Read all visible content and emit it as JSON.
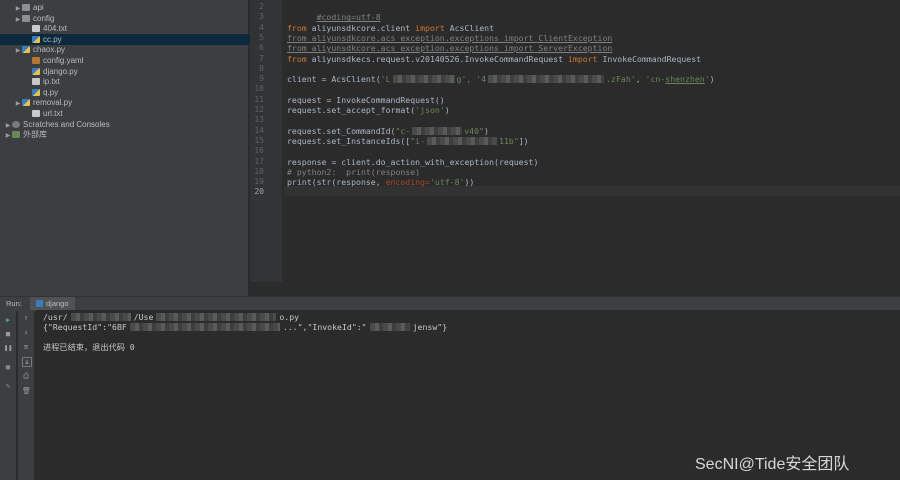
{
  "project_tree": [
    {
      "label": "api",
      "type": "folder",
      "indent": 1,
      "arrow": true,
      "selected": false
    },
    {
      "label": "config",
      "type": "folder",
      "indent": 1,
      "arrow": true,
      "selected": false
    },
    {
      "label": "404.txt",
      "type": "txt",
      "indent": 2,
      "arrow": false,
      "selected": false
    },
    {
      "label": "cc.py",
      "type": "py",
      "indent": 2,
      "arrow": false,
      "selected": true
    },
    {
      "label": "chaox.py",
      "type": "py",
      "indent": 1,
      "arrow": true,
      "selected": false
    },
    {
      "label": "config.yaml",
      "type": "yaml",
      "indent": 2,
      "arrow": false,
      "selected": false
    },
    {
      "label": "django.py",
      "type": "py",
      "indent": 2,
      "arrow": false,
      "selected": false
    },
    {
      "label": "ip.txt",
      "type": "txt",
      "indent": 2,
      "arrow": false,
      "selected": false
    },
    {
      "label": "q.py",
      "type": "py",
      "indent": 2,
      "arrow": false,
      "selected": false
    },
    {
      "label": "removal.py",
      "type": "py",
      "indent": 1,
      "arrow": true,
      "selected": false
    },
    {
      "label": "url.txt",
      "type": "txt",
      "indent": 2,
      "arrow": false,
      "selected": false
    },
    {
      "label": "Scratches and Consoles",
      "type": "scratch",
      "indent": 0,
      "arrow": true,
      "selected": false
    },
    {
      "label": "外部库",
      "type": "lib",
      "indent": 0,
      "arrow": true,
      "selected": false
    }
  ],
  "editor": {
    "line_numbers": [
      "2",
      "3",
      "4",
      "5",
      "6",
      "7",
      "8",
      "9",
      "10",
      "11",
      "12",
      "13",
      "14",
      "15",
      "16",
      "17",
      "18",
      "19",
      "20"
    ],
    "current_line": "20",
    "lines": {
      "l2": "#coding=utf-8",
      "l4_kw1": "from",
      "l4_mod": " aliyunsdkcore.client ",
      "l4_kw2": "import",
      "l4_name": " AcsClient",
      "l5": "from aliyunsdkcore.acs_exception.exceptions import ClientException",
      "l6": "from aliyunsdkcore.acs_exception.exceptions import ServerException",
      "l7_kw1": "from",
      "l7_mod": " aliyunsdkecs.request.v20140526.InvokeCommandRequest ",
      "l7_kw2": "import",
      "l7_name": " InvokeCommandRequest",
      "l9_a": "client = AcsClient(",
      "l9_s1": "'L",
      "l9_s2": "g', '4",
      "l9_s3": ".zFah'",
      "l9_c": ", ",
      "l9_s4": "'cn-",
      "l9_s5": "shenzhen",
      "l9_s6": "'",
      "l9_end": ")",
      "l11": "request = InvokeCommandRequest()",
      "l12_a": "request.set_accept_format(",
      "l12_s": "'json'",
      "l12_end": ")",
      "l14_a": "request.set_CommandId(",
      "l14_s1": "\"c-",
      "l14_s2": "v40\"",
      "l14_end": ")",
      "l15_a": "request.set_InstanceIds([",
      "l15_s1": "\"i-",
      "l15_s2": "11b\"",
      "l15_end": "])",
      "l17": "response = client.do_action_with_exception(request)",
      "l18": "# python2:  print(response)",
      "l19_a": "print(str(response, ",
      "l19_p": "encoding=",
      "l19_s": "'utf-8'",
      "l19_end": "))"
    }
  },
  "run": {
    "label": "Run:",
    "tab": "django",
    "output": {
      "line1_a": "/usr/",
      "line1_b": "/Use",
      "line1_c": "o.py",
      "line2_a": "{\"RequestId\":\"6BF",
      "line2_b": "...\",\"InvokeId\":\"",
      "line2_c": "jensw\"}",
      "line3": "进程已结束，退出代码 0"
    }
  },
  "watermark": "SecNI@Tide安全团队"
}
